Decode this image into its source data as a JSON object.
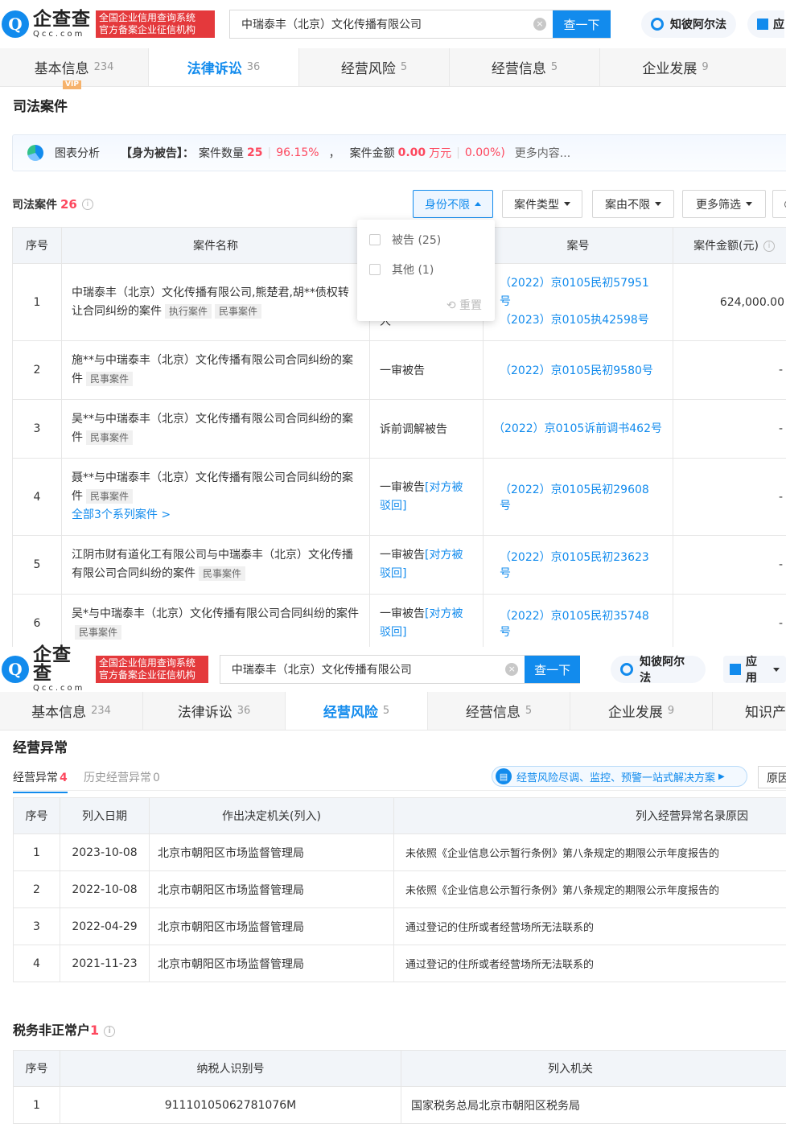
{
  "screen1": {
    "logo": {
      "cn": "企查查",
      "en": "Qcc.com",
      "badge_line1": "全国企业信用查询系统",
      "badge_line2": "官方备案企业征信机构"
    },
    "search": {
      "value": "中瑞泰丰（北京）文化传播有限公司",
      "button": "查一下"
    },
    "assistant": "知彼阿尔法",
    "app_partial": "应",
    "tabs": [
      {
        "label": "基本信息",
        "count": "234"
      },
      {
        "label": "法律诉讼",
        "count": "36"
      },
      {
        "label": "经营风险",
        "count": "5"
      },
      {
        "label": "经营信息",
        "count": "5"
      },
      {
        "label": "企业发展",
        "count": "9"
      }
    ],
    "vip": "VIP",
    "section_title": "司法案件",
    "summary": {
      "chart_link": "图表分析",
      "role": "【身为被告】：",
      "count_label": "案件数量",
      "count": "25",
      "count_pct": "96.15%",
      "sep": "，",
      "amount_label": "案件金额",
      "amount": "0.00",
      "amount_unit": "万元",
      "amount_pct": "0.00%)",
      "more": "更多内容..."
    },
    "cases_label": "司法案件",
    "cases_count": "26",
    "filters": [
      "身份不限",
      "案件类型",
      "案由不限",
      "更多筛选"
    ],
    "dropdown": {
      "items": [
        "被告 (25)",
        "其他 (1)"
      ],
      "reset": "重置"
    },
    "table": {
      "headers": [
        "序号",
        "案件名称",
        "",
        "案号",
        "案件金额(元)"
      ],
      "rows": [
        {
          "no": "1",
          "name": "中瑞泰丰（北京）文化传播有限公司,熊楚君,胡**债权转让合同纠纷的案件",
          "tags": [
            "执行案件",
            "民事案件"
          ],
          "role": "",
          "role_tail": "人",
          "case_nos": [
            "（2022）京0105民初57951号",
            "（2023）京0105执42598号"
          ],
          "amount": "624,000.00"
        },
        {
          "no": "2",
          "name": "施**与中瑞泰丰（北京）文化传播有限公司合同纠纷的案件",
          "tags": [
            "民事案件"
          ],
          "role": "一审被告",
          "role_tail": "",
          "case_nos": [
            "（2022）京0105民初9580号"
          ],
          "amount": "-"
        },
        {
          "no": "3",
          "name": "吴**与中瑞泰丰（北京）文化传播有限公司合同纠纷的案件",
          "tags": [
            "民事案件"
          ],
          "role": "诉前调解被告",
          "role_tail": "",
          "case_nos": [
            "（2022）京0105诉前调书462号"
          ],
          "amount": "-"
        },
        {
          "no": "4",
          "name": "聂**与中瑞泰丰（北京）文化传播有限公司合同纠纷的案件",
          "tags": [
            "民事案件"
          ],
          "series_link": "全部3个系列案件 >",
          "role": "一审被告",
          "role_tail": "[对方被驳回]",
          "case_nos": [
            "（2022）京0105民初29608号"
          ],
          "amount": "-"
        },
        {
          "no": "5",
          "name": "江阴市财有道化工有限公司与中瑞泰丰（北京）文化传播有限公司合同纠纷的案件",
          "tags": [
            "民事案件"
          ],
          "role": "一审被告",
          "role_tail": "[对方被驳回]",
          "case_nos": [
            "（2022）京0105民初23623号"
          ],
          "amount": "-"
        },
        {
          "no": "6",
          "name": "吴*与中瑞泰丰（北京）文化传播有限公司合同纠纷的案件",
          "tags": [
            "民事案件"
          ],
          "role": "一审被告",
          "role_tail": "[对方被驳回]",
          "case_nos": [
            "（2022）京0105民初35748号"
          ],
          "amount": "-"
        }
      ]
    }
  },
  "screen2": {
    "logo": {
      "cn": "企查查",
      "en": "Qcc.com",
      "badge_line1": "全国企业信用查询系统",
      "badge_line2": "官方备案企业征信机构"
    },
    "search": {
      "value": "中瑞泰丰（北京）文化传播有限公司",
      "button": "查一下"
    },
    "assistant": "知彼阿尔法",
    "app": "应用",
    "tabs": [
      {
        "label": "基本信息",
        "count": "234"
      },
      {
        "label": "法律诉讼",
        "count": "36"
      },
      {
        "label": "经营风险",
        "count": "5"
      },
      {
        "label": "经营信息",
        "count": "5"
      },
      {
        "label": "企业发展",
        "count": "9"
      },
      {
        "label": "知识产",
        "count": ""
      }
    ],
    "section_title": "经营异常",
    "subtab_active": "经营异常",
    "subtab_active_count": "4",
    "subtab_other": "历史经营异常",
    "subtab_other_count": "0",
    "promo": "经营风险尽调、监控、预警一站式解决方案",
    "reason_partial": "原因",
    "abn_table": {
      "headers": [
        "序号",
        "列入日期",
        "作出决定机关(列入)",
        "列入经营异常名录原因"
      ],
      "rows": [
        [
          "1",
          "2023-10-08",
          "北京市朝阳区市场监督管理局",
          "未依照《企业信息公示暂行条例》第八条规定的期限公示年度报告的"
        ],
        [
          "2",
          "2022-10-08",
          "北京市朝阳区市场监督管理局",
          "未依照《企业信息公示暂行条例》第八条规定的期限公示年度报告的"
        ],
        [
          "3",
          "2022-04-29",
          "北京市朝阳区市场监督管理局",
          "通过登记的住所或者经营场所无法联系的"
        ],
        [
          "4",
          "2021-11-23",
          "北京市朝阳区市场监督管理局",
          "通过登记的住所或者经营场所无法联系的"
        ]
      ]
    },
    "tax_title": "税务非正常户",
    "tax_count": "1",
    "tax_table": {
      "headers": [
        "序号",
        "纳税人识别号",
        "列入机关"
      ],
      "rows": [
        [
          "1",
          "91110105062781076M",
          "国家税务总局北京市朝阳区税务局"
        ]
      ]
    }
  }
}
